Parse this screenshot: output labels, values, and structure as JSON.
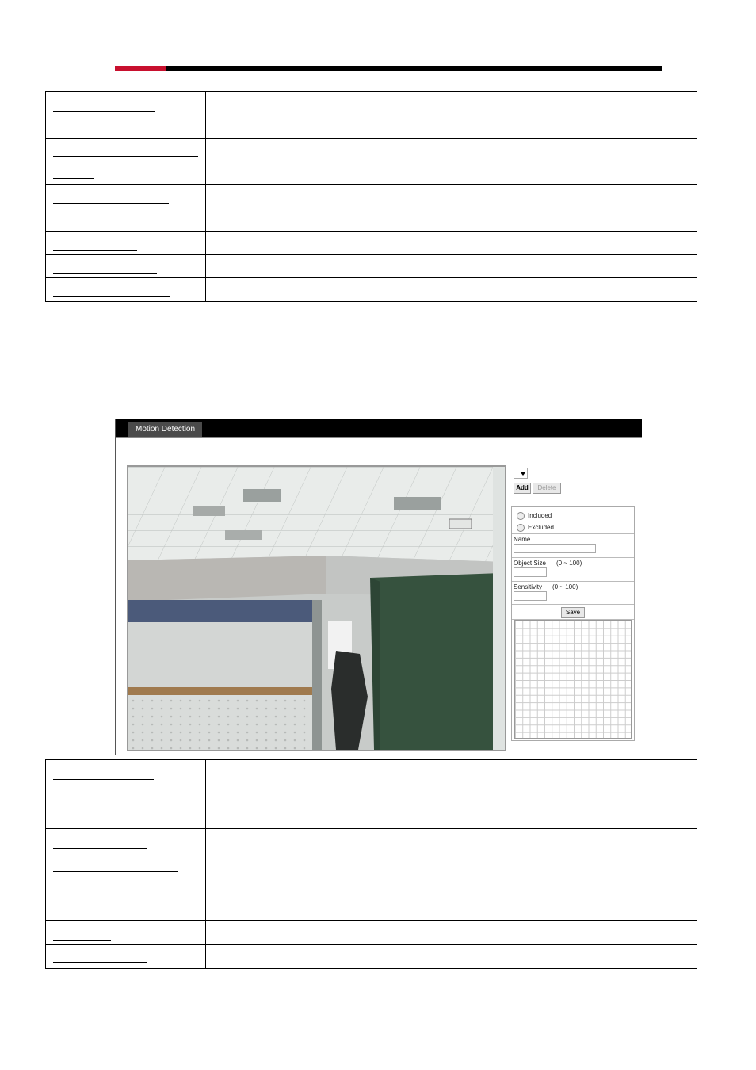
{
  "screenshot": {
    "tab_label": "Motion Detection",
    "add_label": "Add",
    "delete_label": "Delete",
    "included_label": "Included",
    "excluded_label": "Excluded",
    "name_label": "Name",
    "object_size_label": "Object Size",
    "object_size_range": "(0 ~ 100)",
    "sensitivity_label": "Sensitivity",
    "sensitivity_range": "(0 ~ 100)",
    "save_label": "Save"
  },
  "colors": {
    "header_red": "#c8102e",
    "header_black": "#000000"
  }
}
